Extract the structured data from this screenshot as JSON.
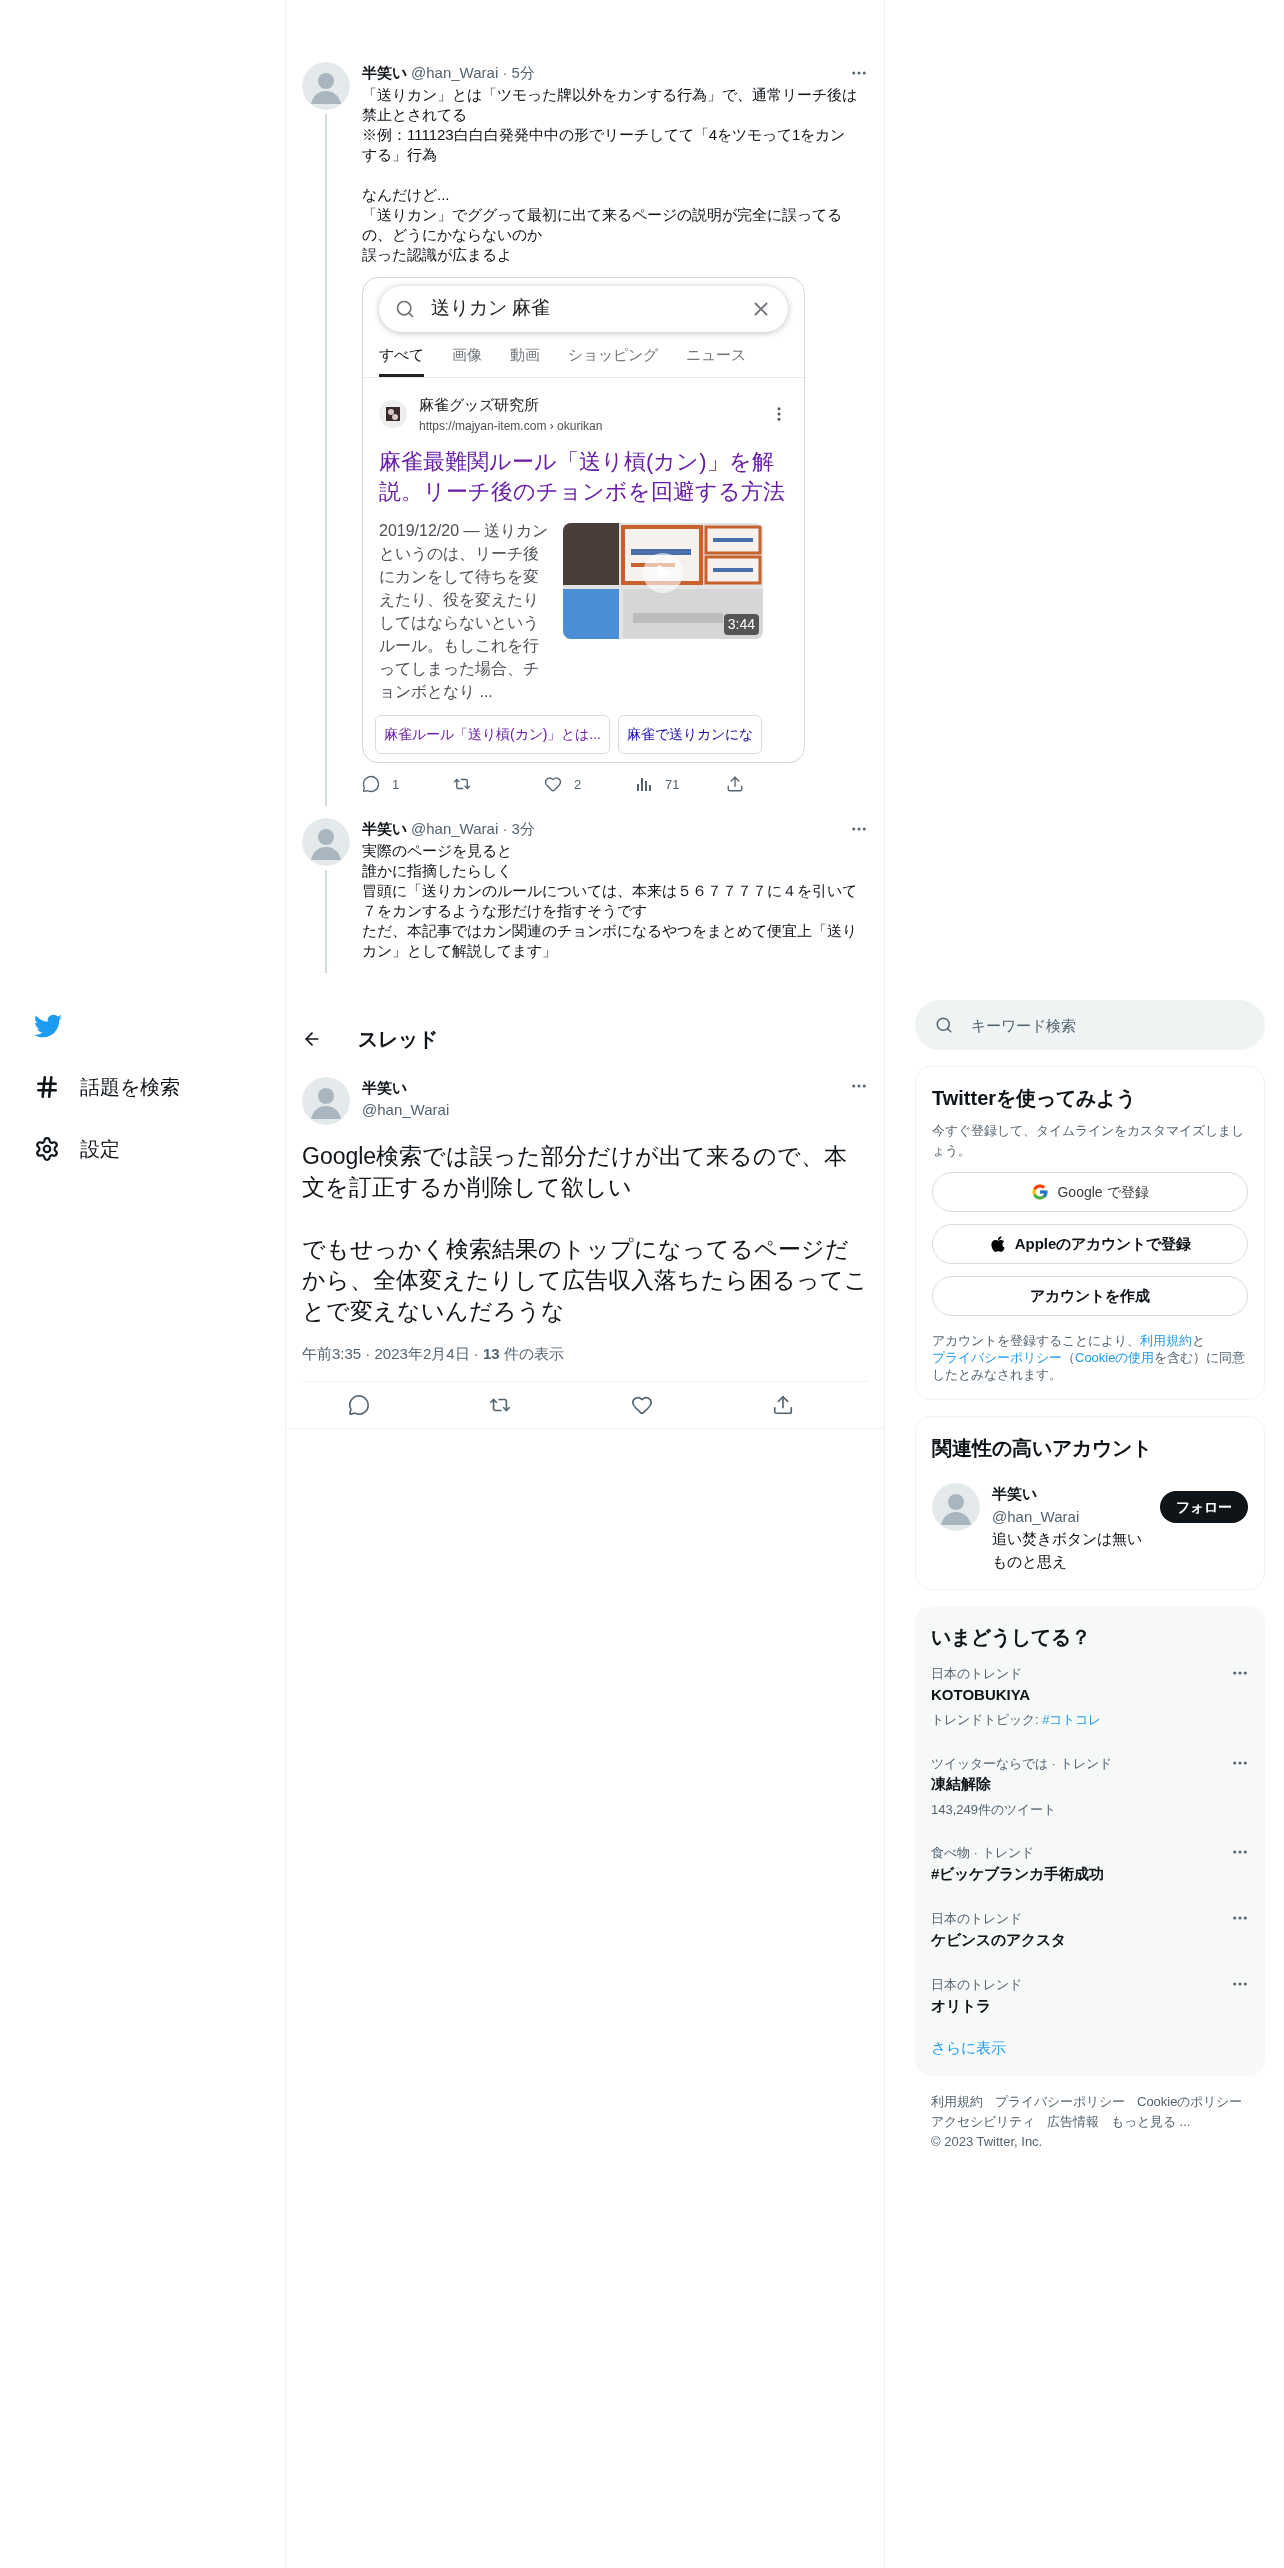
{
  "nav": {
    "items": [
      {
        "kind": "explore",
        "label": "話題を検索"
      },
      {
        "kind": "settings",
        "label": "設定"
      }
    ]
  },
  "thread": [
    {
      "name": "半笑い",
      "byline": "@han_Warai · 5分",
      "paragraphs": [
        [
          "「送りカン」とは「ツモった牌以外をカンする行為」で、通常リーチ後は禁止とされてる",
          "※例：111123白白白発発中中の形でリーチしてて「4をツモって1をカンする」行為"
        ],
        [
          "なんだけど...",
          "「送りカン」でググって最初に出て来るページの説明が完全に誤ってるの、どうにかならないのか",
          "誤った認識が広まるよ"
        ]
      ],
      "embed": {
        "query": "送りカン 麻雀",
        "tabs": [
          {
            "label": "すべて",
            "selected": true
          },
          {
            "label": "画像",
            "selected": false
          },
          {
            "label": "動画",
            "selected": false
          },
          {
            "label": "ショッピング",
            "selected": false
          },
          {
            "label": "ニュース",
            "selected": false
          }
        ],
        "site": "麻雀グッズ研究所",
        "url": "https://majyan-item.com › okurikan",
        "title": "麻雀最難関ルール「送り槓(カン)」を解説。リーチ後のチョンボを回避する方法",
        "snippet": "2019/12/20 — 送りカンというのは、リーチ後にカンをして待ちを変えたり、役を変えたりしてはならないというルール。もしこれを行ってしまった場合、チョンボとなり ...",
        "duration": "3:44",
        "chips": [
          {
            "label": "麻雀ルール「送り槓(カン)」とは...",
            "visited": true
          },
          {
            "label": "麻雀で送りカンにな",
            "visited": false
          }
        ]
      },
      "actions": [
        {
          "kind": "reply",
          "count": "1"
        },
        {
          "kind": "retweet"
        },
        {
          "kind": "like",
          "count": "2"
        },
        {
          "kind": "views",
          "count": "71"
        },
        {
          "kind": "share"
        }
      ]
    },
    {
      "name": "半笑い",
      "byline": "@han_Warai · 3分",
      "paragraphs": [
        [
          "実際のページを見ると",
          "誰かに指摘したらしく",
          "冒頭に「送りカンのルールについては、本来は５６７７７７に４を引いて７をカンするような形だけを指すそうです",
          "ただ、本記事ではカン関連のチョンボになるやつをまとめて便宜上「送りカン」として解説してます」"
        ]
      ]
    }
  ],
  "header": {
    "title": "スレッド"
  },
  "main_tweet": {
    "name": "半笑い",
    "handle": "@han_Warai",
    "paragraphs": [
      [
        "Google検索では誤った部分だけが出て来るので、本文を訂正するか削除して欲しい"
      ],
      [
        "でもせっかく検索結果のトップになってるページだから、全体変えたりして広告収入落ちたら困るってことで変えないんだろうな"
      ]
    ],
    "meta": "午前3:35 · 2023年2月4日 · **13** 件の表示",
    "actions": [
      {
        "kind": "reply"
      },
      {
        "kind": "retweet"
      },
      {
        "kind": "like"
      },
      {
        "kind": "share"
      }
    ]
  },
  "sidebar": {
    "search": {
      "placeholder": "キーワード検索"
    },
    "signup": {
      "title": "Twitterを使ってみよう",
      "subtitle": "今すぐ登録して、タイムラインをカスタマイズしましょう。",
      "buttons": [
        {
          "kind": "google",
          "label": "Google で登録"
        },
        {
          "kind": "apple",
          "label": "Appleのアカウントで登録"
        },
        {
          "kind": "create",
          "label": "アカウントを作成"
        }
      ],
      "legal": [
        {
          "text": "アカウントを登録することにより、",
          "link": false
        },
        {
          "text": "利用規約",
          "link": true
        },
        {
          "text": "と",
          "link": false
        },
        {
          "text": "プライバシーポリシー",
          "link": true
        },
        {
          "text": "（",
          "link": false
        },
        {
          "text": "Cookieの使用",
          "link": true
        },
        {
          "text": "を含む）に同意したとみなされます。",
          "link": false
        }
      ]
    },
    "related": {
      "title": "関連性の高いアカウント",
      "accounts": [
        {
          "name": "半笑い",
          "handle": "@han_Warai",
          "bio": "追い焚きボタンは無いものと思え",
          "follow": "フォロー"
        }
      ]
    },
    "trends": {
      "title": "いまどうしてる？",
      "items": [
        {
          "context": "日本のトレンド",
          "topic": "KOTOBUKIYA",
          "meta": "トレンドトピック: ",
          "meta_link": "#コトコレ"
        },
        {
          "context": "ツイッターならでは · トレンド",
          "topic": "凍結解除",
          "meta": "143,249件のツイート"
        },
        {
          "context": "食べ物 · トレンド",
          "topic": "#ビッケブランカ手術成功"
        },
        {
          "context": "日本のトレンド",
          "topic": "ケビンスのアクスタ"
        },
        {
          "context": "日本のトレンド",
          "topic": "オリトラ"
        }
      ],
      "more": "さらに表示"
    },
    "footer": [
      "利用規約",
      "プライバシーポリシー",
      "Cookieのポリシー",
      "アクセシビリティ",
      "広告情報",
      "もっと見る ...",
      "© 2023 Twitter, Inc."
    ]
  }
}
